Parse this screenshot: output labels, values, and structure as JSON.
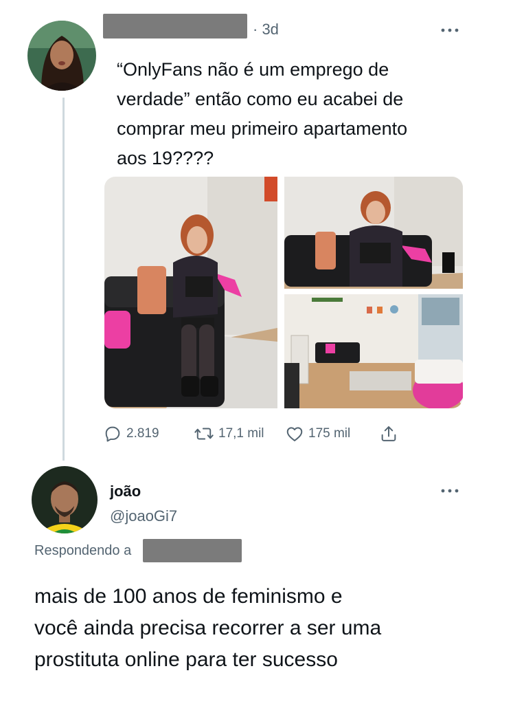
{
  "original_tweet": {
    "timestamp": "· 3d",
    "text": "“OnlyFans não é um emprego de\nverdade” então como eu acabei de\ncomprar meu primeiro apartamento\naos 19????",
    "stats": {
      "replies": "2.819",
      "retweets": "17,1 mil",
      "likes": "175 mil"
    }
  },
  "reply_tweet": {
    "name": "joão",
    "handle": "@joaoGi7",
    "replying_label": "Respondendo a",
    "text": "mais de 100 anos de feminismo e\nvocê ainda precisa recorrer a ser uma\nprostituta online para ter sucesso"
  },
  "icons": {
    "more": "more-horizontal-icon",
    "reply": "reply-icon",
    "retweet": "retweet-icon",
    "like": "heart-icon",
    "share": "share-icon"
  },
  "colors": {
    "text": "#0f1419",
    "secondary": "#536471",
    "thread_line": "#cfd9de",
    "redaction": "#7b7b7b"
  }
}
